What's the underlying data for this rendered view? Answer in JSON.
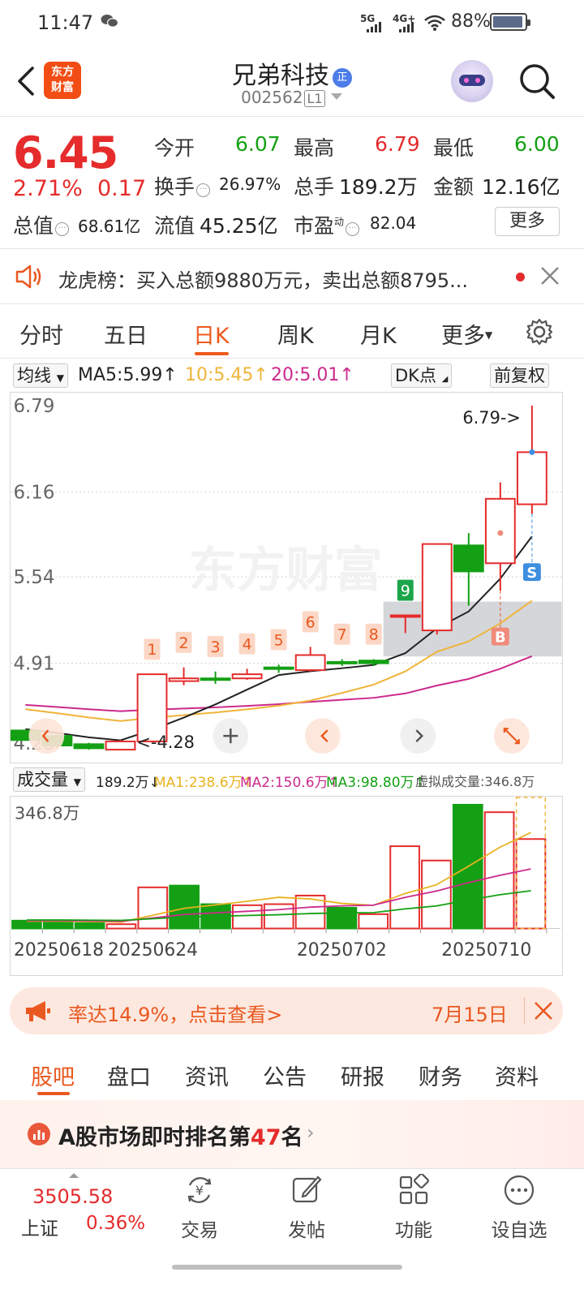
{
  "status": {
    "time": "11:47",
    "sig1": "5G",
    "sig2": "4G+",
    "battery": "88%"
  },
  "header": {
    "logo_line1": "东方",
    "logo_line2": "财富",
    "stock_name": "兄弟科技",
    "name_badge": "正",
    "stock_code": "002562",
    "level": "L1"
  },
  "quote": {
    "price": "6.45",
    "change_pct": "2.71%",
    "change": "0.17",
    "open_label": "今开",
    "open": "6.07",
    "high_label": "最高",
    "high": "6.79",
    "low_label": "最低",
    "low": "6.00",
    "turnover_label": "换手",
    "turnover": "26.97%",
    "volume_label": "总手",
    "volume": "189.2万",
    "amount_label": "金额",
    "amount": "12.16亿",
    "mktcap_label": "总值",
    "mktcap": "68.61亿",
    "float_label": "流值",
    "float": "45.25亿",
    "pe_label": "市盈",
    "pe_sup": "动",
    "pe": "82.04",
    "more_label": "更多"
  },
  "notice": {
    "text": "龙虎榜：买入总额9880万元，卖出总额8795..."
  },
  "period_tabs": [
    "分时",
    "五日",
    "日K",
    "周K",
    "月K",
    "更多"
  ],
  "ma_row": {
    "selector": "均线",
    "ma5": "MA5:5.99↑",
    "ma10": "10:5.45↑",
    "ma20": "20:5.01↑",
    "dk_btn": "DK点",
    "fq_btn": "前复权"
  },
  "colors": {
    "up": "#e52b2b",
    "down": "#14a014",
    "accent": "#ee5a1e",
    "ma5": "#222222",
    "ma10": "#f0b43a",
    "ma20": "#cc2a8c"
  },
  "chart_data": [
    {
      "type": "candlestick",
      "title": "日K",
      "y_ticks": [
        "6.79",
        "6.16",
        "5.54",
        "4.91",
        "4.28"
      ],
      "ylim": [
        4.28,
        6.79
      ],
      "max_marker": "6.79->",
      "min_marker": "<-4.28",
      "candles": [
        {
          "o": 4.42,
          "c": 4.35,
          "h": 4.42,
          "l": 4.35
        },
        {
          "o": 4.38,
          "c": 4.31,
          "h": 4.39,
          "l": 4.29
        },
        {
          "o": 4.32,
          "c": 4.29,
          "h": 4.33,
          "l": 4.28
        },
        {
          "o": 4.28,
          "c": 4.34,
          "h": 4.35,
          "l": 4.28
        },
        {
          "o": 4.34,
          "c": 4.83,
          "h": 4.83,
          "l": 4.34
        },
        {
          "o": 4.78,
          "c": 4.8,
          "h": 4.88,
          "l": 4.75
        },
        {
          "o": 4.8,
          "c": 4.79,
          "h": 4.85,
          "l": 4.76
        },
        {
          "o": 4.8,
          "c": 4.83,
          "h": 4.87,
          "l": 4.79
        },
        {
          "o": 4.88,
          "c": 4.87,
          "h": 4.9,
          "l": 4.84
        },
        {
          "o": 4.86,
          "c": 4.97,
          "h": 5.03,
          "l": 4.85
        },
        {
          "o": 4.92,
          "c": 4.91,
          "h": 4.94,
          "l": 4.89
        },
        {
          "o": 4.93,
          "c": 4.91,
          "h": 4.94,
          "l": 4.89
        },
        {
          "o": 5.26,
          "c": 5.26,
          "h": 5.26,
          "l": 5.13
        },
        {
          "o": 5.15,
          "c": 5.78,
          "h": 5.78,
          "l": 5.12
        },
        {
          "o": 5.77,
          "c": 5.58,
          "h": 5.86,
          "l": 5.33
        },
        {
          "o": 5.64,
          "c": 6.11,
          "h": 6.23,
          "l": 5.44
        },
        {
          "o": 6.07,
          "c": 6.45,
          "h": 6.79,
          "l": 6.0
        }
      ],
      "signals": [
        "1",
        "2",
        "3",
        "4",
        "5",
        "6",
        "7",
        "8",
        "9"
      ],
      "markers": {
        "buy": "B",
        "sell": "S"
      },
      "ma": {
        "ma5_name": "MA5",
        "ma10_name": "MA10",
        "ma20_name": "MA20"
      },
      "watermark": "东方财富"
    },
    {
      "type": "bar",
      "title": "成交量",
      "max_label": "346.8万",
      "summary": "189.2万↓",
      "ma1": "MA1:238.6万↑",
      "ma2": "MA2:150.6万↑",
      "ma3": "MA3:98.80万↑",
      "virtual": "虚拟成交量:346.8万",
      "values": [
        22,
        20,
        15,
        12,
        115,
        120,
        68,
        65,
        68,
        92,
        58,
        40,
        230,
        190,
        346,
        325,
        250
      ],
      "up": [
        false,
        false,
        false,
        true,
        true,
        false,
        false,
        true,
        true,
        true,
        false,
        true,
        true,
        true,
        false,
        true,
        true
      ],
      "x_labels": [
        "20250618",
        "20250624",
        "20250702",
        "20250710"
      ]
    }
  ],
  "ad": {
    "text": "率达14.9%，点击查看>",
    "date": "7月15日"
  },
  "bottom_tabs": [
    "股吧",
    "盘口",
    "资讯",
    "公告",
    "研报",
    "财务",
    "资料"
  ],
  "rank": {
    "prefix": "A股市场即时排名第",
    "num": "47",
    "suffix": "名"
  },
  "index": {
    "value": "3505.58",
    "name": "上证",
    "pct": "0.36%"
  },
  "nav": [
    "交易",
    "发帖",
    "功能",
    "设自选"
  ]
}
